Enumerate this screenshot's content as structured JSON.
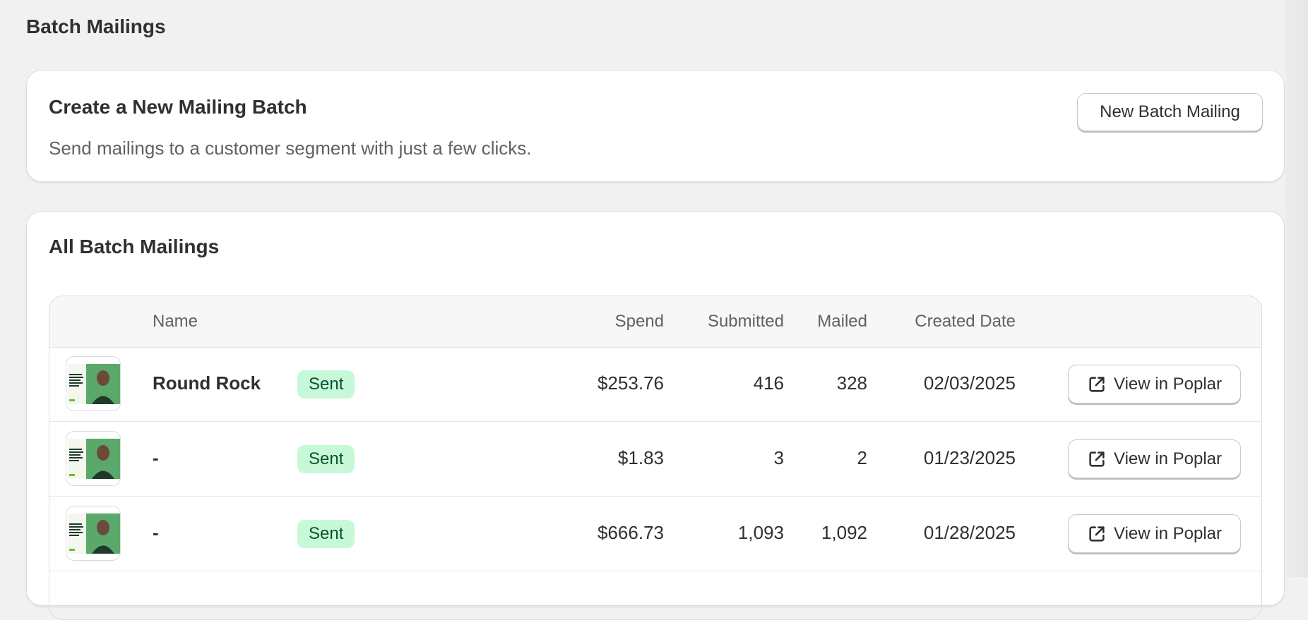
{
  "page": {
    "title": "Batch Mailings"
  },
  "create_card": {
    "title": "Create a New Mailing Batch",
    "description": "Send mailings to a customer segment with just a few clicks.",
    "button_label": "New Batch Mailing"
  },
  "all_card": {
    "title": "All Batch Mailings",
    "columns": {
      "name": "Name",
      "spend": "Spend",
      "submitted": "Submitted",
      "mailed": "Mailed",
      "created_date": "Created Date"
    },
    "rows": [
      {
        "name": "Round Rock",
        "status": "Sent",
        "spend": "$253.76",
        "submitted": "416",
        "mailed": "328",
        "created_date": "02/03/2025",
        "action": "View in Poplar"
      },
      {
        "name": "-",
        "status": "Sent",
        "spend": "$1.83",
        "submitted": "3",
        "mailed": "2",
        "created_date": "01/23/2025",
        "action": "View in Poplar"
      },
      {
        "name": "-",
        "status": "Sent",
        "spend": "$666.73",
        "submitted": "1,093",
        "mailed": "1,092",
        "created_date": "01/28/2025",
        "action": "View in Poplar"
      }
    ]
  },
  "colors": {
    "badge_bg": "#c7f9d8",
    "badge_text": "#0c5132",
    "page_bg": "#f1f1f1"
  },
  "icons": {
    "view_action": "external-link-icon",
    "thumbnail": "mailer-thumbnail"
  }
}
